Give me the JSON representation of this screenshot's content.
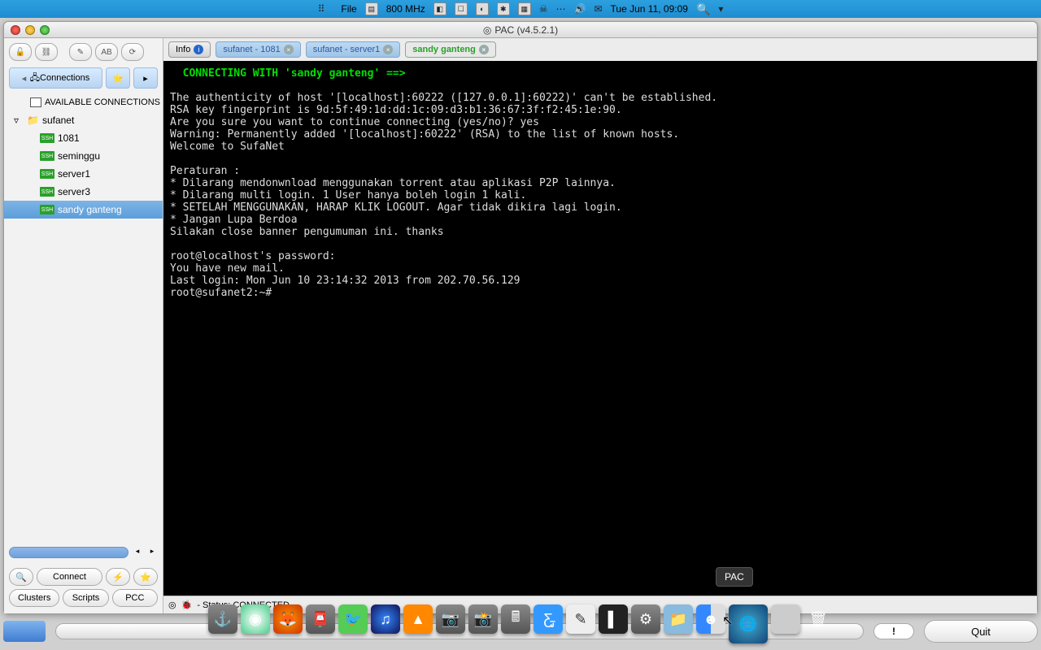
{
  "menubar": {
    "file": "File",
    "cpu": "800 MHz",
    "clock": "Tue Jun 11, 09:09"
  },
  "window": {
    "title": "PAC (v4.5.2.1)"
  },
  "sidebar": {
    "tab_label": "Connections",
    "header": "AVAILABLE CONNECTIONS",
    "folder": "sufanet",
    "items": [
      "1081",
      "seminggu",
      "server1",
      "server3",
      "sandy ganteng"
    ],
    "selected_index": 4,
    "buttons": {
      "connect": "Connect",
      "clusters": "Clusters",
      "scripts": "Scripts",
      "pcc": "PCC"
    }
  },
  "tabs": {
    "info": "Info",
    "items": [
      "sufanet - 1081",
      "sufanet - server1",
      "sandy ganteng"
    ],
    "active_index": 2
  },
  "terminal": {
    "header": "  CONNECTING WITH 'sandy ganteng' ==>",
    "lines": [
      "",
      "The authenticity of host '[localhost]:60222 ([127.0.0.1]:60222)' can't be established.",
      "RSA key fingerprint is 9d:5f:49:1d:dd:1c:09:d3:b1:36:67:3f:f2:45:1e:90.",
      "Are you sure you want to continue connecting (yes/no)? yes",
      "Warning: Permanently added '[localhost]:60222' (RSA) to the list of known hosts.",
      "Welcome to SufaNet",
      "",
      "Peraturan :",
      "* Dilarang mendonwnload menggunakan torrent atau aplikasi P2P lainnya.",
      "* Dilarang multi login. 1 User hanya boleh login 1 kali.",
      "* SETELAH MENGGUNAKAN, HARAP KLIK LOGOUT. Agar tidak dikira lagi login.",
      "* Jangan Lupa Berdoa",
      "Silakan close banner pengumuman ini. thanks",
      "",
      "root@localhost's password:",
      "You have new mail.",
      "Last login: Mon Jun 10 23:14:32 2013 from 202.70.56.129",
      "root@sufanet2:~#"
    ]
  },
  "statusbar": {
    "text": "- Status: CONNECTED"
  },
  "tooltip": "PAC",
  "footer": {
    "quit": "Quit",
    "bang": "!"
  }
}
